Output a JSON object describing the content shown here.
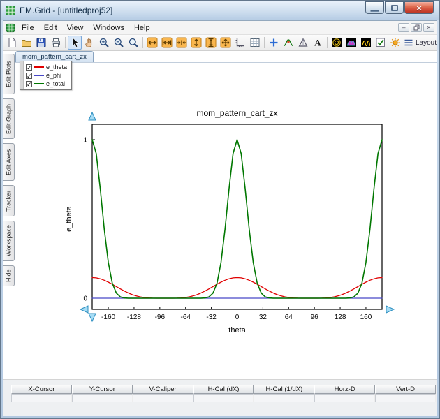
{
  "window": {
    "title": "EM.Grid - [untitledproj52]",
    "controls": {
      "minimize_glyph": "—",
      "maximize_glyph": "max",
      "close_glyph": "×"
    }
  },
  "menubar": {
    "items": [
      "File",
      "Edit",
      "View",
      "Windows",
      "Help"
    ],
    "mdi_minimize_glyph": "–",
    "mdi_close_glyph": "×"
  },
  "toolbar": {
    "layout_label": "Layout",
    "icons": {
      "app-icon": "green grid logo",
      "new-file-icon": "blank page",
      "open-folder-icon": "yellow folder",
      "save-icon": "blue floppy disk",
      "print-icon": "printer",
      "select-tool-icon": "arrow cursor, active state",
      "pan-tool-icon": "hand",
      "zoom-in-icon": "magnifier with plus",
      "zoom-out-icon": "magnifier with minus",
      "zoom-window-icon": "magnifier",
      "fit-width-icon": "orange horizontal double arrow",
      "expand-x-icon": "orange horizontal arrows with end bars",
      "shrink-x-icon": "orange inward horizontal arrows",
      "fit-height-icon": "orange vertical double arrow",
      "expand-y-icon": "orange vertical arrows with end bars",
      "fit-all-icon": "orange four-way arrows",
      "axes-icon": "gray axes with ticks",
      "grid-icon": "grid table",
      "add-marker-icon": "blue plus",
      "tracker-icon": "green curve with red point",
      "caliper-icon": "triangle with vertical line",
      "text-label-icon": "letter A",
      "radiation-polar-icon": "black square with yellow circles",
      "radiation-3d-icon": "black square with magenta lobe",
      "radiation-cart-icon": "black square with yellow peaks",
      "show-legend-icon": "checkbox with green check",
      "options-icon": "orange sun",
      "layout-lines-icon": "three horizontal lines",
      "axis-arrow-icons": "light blue pan arrows at axis ends"
    }
  },
  "doc_tab": {
    "label": "mom_pattern_cart_zx"
  },
  "side_tabs": {
    "items": [
      "Edit Plots",
      "Edit Graph",
      "Edit Axes",
      "Tracker",
      "Workspace",
      "Hide"
    ]
  },
  "legend": {
    "items": [
      {
        "label": "e_theta",
        "color": "#e00000",
        "checked": true
      },
      {
        "label": "e_phi",
        "color": "#4848c8",
        "checked": true
      },
      {
        "label": "e_total",
        "color": "#007700",
        "checked": true
      }
    ]
  },
  "readout": {
    "headers": [
      "X-Cursor",
      "Y-Cursor",
      "V-Caliper",
      "H-Cal (dX)",
      "H-Cal (1/dX)",
      "Horz-D",
      "Vert-D"
    ],
    "values": [
      "",
      "",
      "",
      "",
      "",
      "",
      ""
    ]
  },
  "chart_data": {
    "type": "line",
    "title": "mom_pattern_cart_zx",
    "xlabel": "theta",
    "ylabel": "e_theta",
    "xlim": [
      -180,
      180
    ],
    "ylim": [
      -0.07,
      1.1
    ],
    "xticks": [
      -160,
      -128,
      -96,
      -64,
      -32,
      0,
      32,
      64,
      96,
      128,
      160
    ],
    "yticks": [
      0,
      1
    ],
    "grid": false,
    "legend_position": "top-left floating",
    "x": [
      -180,
      -175,
      -170,
      -165,
      -160,
      -155,
      -150,
      -145,
      -140,
      -135,
      -130,
      -125,
      -120,
      -115,
      -110,
      -105,
      -100,
      -95,
      -90,
      -85,
      -80,
      -75,
      -70,
      -65,
      -60,
      -55,
      -50,
      -45,
      -40,
      -35,
      -30,
      -25,
      -20,
      -15,
      -10,
      -5,
      0,
      5,
      10,
      15,
      20,
      25,
      30,
      35,
      40,
      45,
      50,
      55,
      60,
      65,
      70,
      75,
      80,
      85,
      90,
      95,
      100,
      105,
      110,
      115,
      120,
      125,
      130,
      135,
      140,
      145,
      150,
      155,
      160,
      165,
      170,
      175,
      180
    ],
    "series": [
      {
        "name": "e_theta",
        "color": "#e00000",
        "values": [
          0.13,
          0.128,
          0.1223,
          0.1132,
          0.1014,
          0.0877,
          0.0731,
          0.0585,
          0.0448,
          0.0325,
          0.0222,
          0.0141,
          0.0081,
          0.0041,
          0.0018,
          0.0006,
          0.0001,
          0,
          0,
          0,
          0.0001,
          0.0006,
          0.0018,
          0.0041,
          0.0081,
          0.0141,
          0.0222,
          0.0325,
          0.0448,
          0.0585,
          0.0731,
          0.0877,
          0.1014,
          0.1132,
          0.1223,
          0.128,
          0.13,
          0.128,
          0.1223,
          0.1132,
          0.1014,
          0.0877,
          0.0731,
          0.0585,
          0.0448,
          0.0325,
          0.0222,
          0.0141,
          0.0081,
          0.0041,
          0.0018,
          0.0006,
          0.0001,
          0,
          0,
          0,
          0.0001,
          0.0006,
          0.0018,
          0.0041,
          0.0081,
          0.0141,
          0.0222,
          0.0325,
          0.0448,
          0.0585,
          0.0731,
          0.0877,
          0.1014,
          0.1132,
          0.1223,
          0.128,
          0.13
        ]
      },
      {
        "name": "e_phi",
        "color": "#4848c8",
        "values": [
          0,
          0,
          0,
          0,
          0,
          0,
          0,
          0,
          0,
          0,
          0,
          0,
          0,
          0,
          0,
          0,
          0,
          0,
          0,
          0,
          0,
          0,
          0,
          0,
          0,
          0,
          0,
          0,
          0,
          0,
          0,
          0,
          0,
          0,
          0,
          0,
          0,
          0,
          0,
          0,
          0,
          0,
          0,
          0,
          0,
          0,
          0,
          0,
          0,
          0,
          0,
          0,
          0,
          0,
          0,
          0,
          0,
          0,
          0,
          0,
          0,
          0,
          0,
          0,
          0,
          0,
          0,
          0,
          0,
          0,
          0,
          0,
          0
        ]
      },
      {
        "name": "e_total",
        "color": "#007700",
        "values": [
          1,
          0.9125,
          0.6925,
          0.4352,
          0.2247,
          0.0943,
          0.0317,
          0.0083,
          0.0017,
          0.0002,
          0,
          0,
          0,
          0,
          0,
          0,
          0,
          0,
          0,
          0,
          0,
          0,
          0,
          0,
          0,
          0,
          0,
          0.0002,
          0.0017,
          0.0083,
          0.0317,
          0.0943,
          0.2247,
          0.4352,
          0.6925,
          0.9125,
          1,
          0.9125,
          0.6925,
          0.4352,
          0.2247,
          0.0943,
          0.0317,
          0.0083,
          0.0017,
          0.0002,
          0,
          0,
          0,
          0,
          0,
          0,
          0,
          0,
          0,
          0,
          0,
          0,
          0,
          0,
          0,
          0,
          0,
          0.0002,
          0.0017,
          0.0083,
          0.0317,
          0.0943,
          0.2247,
          0.4352,
          0.6925,
          0.9125,
          1
        ]
      }
    ]
  }
}
